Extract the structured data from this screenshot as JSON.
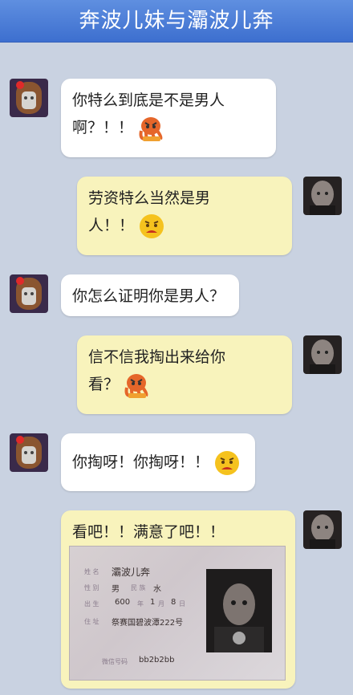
{
  "header": {
    "title": "奔波儿妹与灞波儿奔"
  },
  "messages": [
    {
      "line1": "你特么到底是不是男人",
      "line2": "啊？！！",
      "icon": "angry-octopus-icon"
    },
    {
      "line1": "劳资特么当然是男",
      "line2": "人！！",
      "icon": "angry-smiley-icon"
    },
    {
      "line1": "你怎么证明你是男人？"
    },
    {
      "line1": "信不信我掏出来给你",
      "line2": "看？",
      "icon": "angry-octopus-icon"
    },
    {
      "line1": "你掏呀！你掏呀！！",
      "icon": "angry-smiley-icon"
    },
    {
      "line1": "看吧！！满意了吧！！"
    }
  ],
  "idcard": {
    "name_label": "姓 名",
    "name": "灞波儿奔",
    "sex_label": "性 别",
    "sex": "男",
    "ethnicity_label": "民 族",
    "ethnicity": "水",
    "birth_label": "出 生",
    "birth_year": "600",
    "year_unit": "年",
    "birth_month": "1",
    "month_unit": "月",
    "birth_day": "8",
    "day_unit": "日",
    "address_label": "住 址",
    "address": "祭赛国碧波潭222号",
    "wechat_label": "微信号码",
    "wechat": "bb2b2bb"
  },
  "colors": {
    "header": "#4a7bd9",
    "background": "#c9d2e1",
    "bubble_self": "#f8f3bc",
    "bubble_other": "#ffffff"
  }
}
